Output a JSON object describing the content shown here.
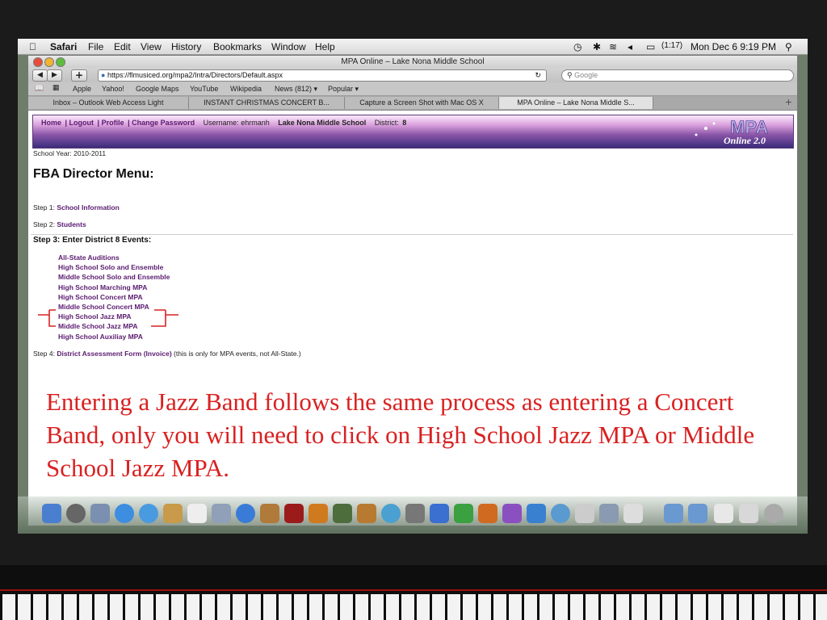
{
  "menubar": {
    "apple": "",
    "app": "Safari",
    "items": [
      "File",
      "Edit",
      "View",
      "History",
      "Bookmarks",
      "Window",
      "Help"
    ],
    "battery": "(1:17)",
    "clock": "Mon Dec 6  9:19 PM"
  },
  "window": {
    "title": "MPA Online – Lake Nona Middle School",
    "url": "https://flmusiced.org/mpa2/Intra/Directors/Default.aspx",
    "search_placeholder": "Google"
  },
  "bookmarks": [
    "Apple",
    "Yahoo!",
    "Google Maps",
    "YouTube",
    "Wikipedia",
    "News (812) ▾",
    "Popular ▾"
  ],
  "tabs": [
    "Inbox – Outlook Web Access Light",
    "INSTANT CHRISTMAS CONCERT B...",
    "Capture a Screen Shot with Mac OS X",
    "MPA Online – Lake Nona Middle S..."
  ],
  "banner": {
    "links": [
      "Home",
      "Logout",
      "Profile",
      "Change Password"
    ],
    "username_label": "Username: ehrmanh",
    "school": "Lake Nona Middle School",
    "district_label": "District:",
    "district": "8",
    "logo_text": "MPA",
    "logo_sub": "Online 2.0"
  },
  "page": {
    "school_year": "School Year: 2010-2011",
    "title": "FBA Director Menu:",
    "step1_label": "Step 1:",
    "step1_link": "School Information",
    "step2_label": "Step 2:",
    "step2_link": "Students",
    "step3": "Step 3: Enter District 8 Events:",
    "events": [
      "All-State Auditions",
      "High School Solo and Ensemble",
      "Middle School Solo and Ensemble",
      "High School Marching MPA",
      "High School Concert MPA",
      "Middle School Concert MPA",
      "High School Jazz MPA",
      "Middle School Jazz MPA",
      "High School Auxiliay MPA"
    ],
    "step4_label": "Step 4:",
    "step4_link": "District Assessment Form (Invoice)",
    "step4_note": "(this is only for MPA events, not All-State.)"
  },
  "caption": "Entering a Jazz Band follows the same process as entering a Concert Band, only you will need to click on High School Jazz MPA or Middle School Jazz MPA.",
  "colors": {
    "link": "#5a1b6f",
    "caption": "#d92121",
    "bracket": "#d92121"
  }
}
